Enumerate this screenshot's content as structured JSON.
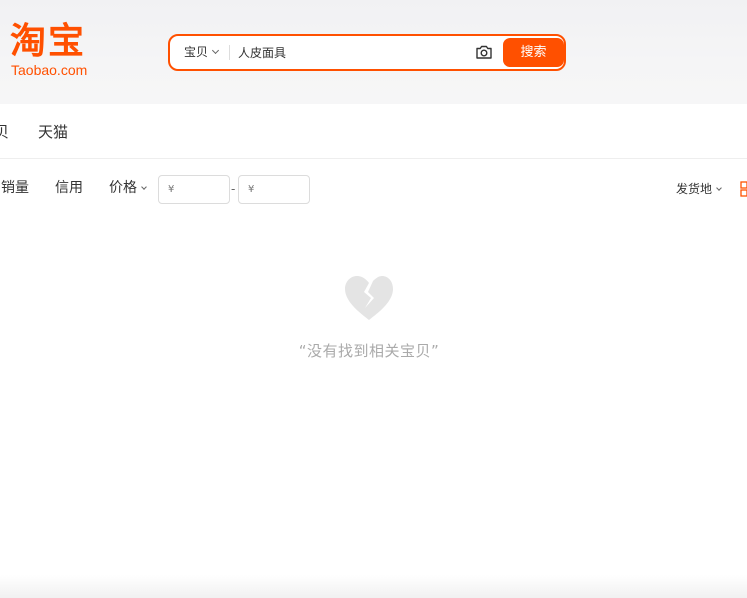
{
  "header": {
    "logo_cn": "淘宝",
    "logo_en": "Taobao.com",
    "search": {
      "type_label": "宝贝",
      "query": "人皮面具",
      "button_label": "搜索"
    }
  },
  "tabs": [
    {
      "label": "贝"
    },
    {
      "label": "天猫"
    }
  ],
  "sort_bar": {
    "sales_label": "销量",
    "credit_label": "信用",
    "price_label": "价格",
    "price_min_placeholder": "¥",
    "price_max_placeholder": "¥",
    "price_separator": "-",
    "ship_from_label": "发货地"
  },
  "empty_state": {
    "message": "“没有找到相关宝贝”"
  },
  "colors": {
    "brand": "#ff5000",
    "empty_text": "#aaaaaa",
    "heart_icon": "#e4e4e4"
  },
  "icons": {
    "camera": "camera-icon",
    "heart": "broken-heart-icon",
    "grid": "grid-view-icon"
  }
}
